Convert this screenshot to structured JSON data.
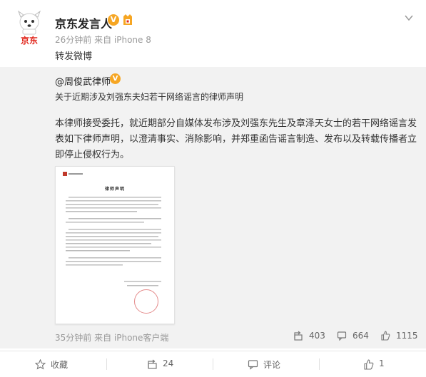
{
  "post": {
    "author": "京东发言人",
    "meta": "26分钟前 来自 iPhone 8",
    "text": "转发微博"
  },
  "avatar_logo_text": "京东",
  "repost": {
    "author": "@周俊武律师",
    "title": "关于近期涉及刘强东夫妇若干网络谣言的律师声明",
    "body": "本律师接受委托，就近期部分自媒体发布涉及刘强东先生及章泽天女士的若干网络谣言发表如下律师声明，以澄清事实、消除影响，并郑重函告谣言制造、发布以及转载传播者立即停止侵权行为。",
    "doc_title": "律师声明",
    "time": "35分钟前 来自 iPhone客户端",
    "reposts": "403",
    "comments": "664",
    "likes": "1115"
  },
  "actions": {
    "collect": "收藏",
    "repost": "24",
    "comment": "评论",
    "like": "1"
  },
  "colors": {
    "badge": "#f6a623",
    "brand_red": "#e1251b"
  },
  "icons": [
    "jd-dog-avatar-icon",
    "verified-v-icon",
    "vip-icon",
    "chevron-down-icon",
    "repost-icon",
    "comment-icon",
    "like-icon",
    "star-icon"
  ]
}
